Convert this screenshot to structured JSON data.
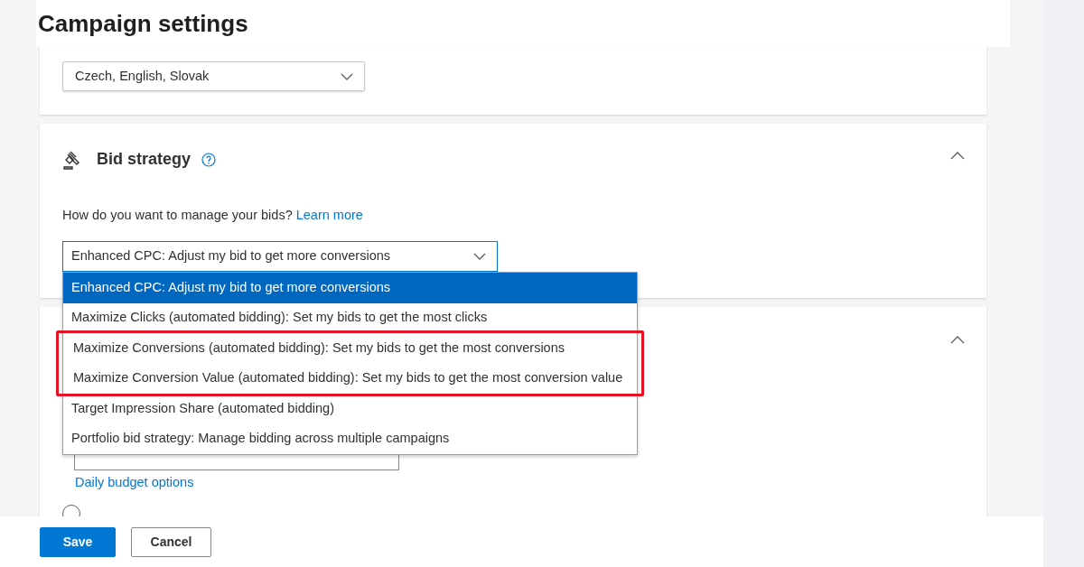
{
  "page": {
    "title": "Campaign settings"
  },
  "languages": {
    "value": "Czech, English, Slovak"
  },
  "bid_strategy": {
    "title": "Bid strategy",
    "expanded": true,
    "prompt": "How do you want to manage your bids?",
    "link": "Learn more",
    "dropdown": {
      "value": "Enhanced CPC: Adjust my bid to get more conversions",
      "expanded": true,
      "options": [
        {
          "label": "Enhanced CPC: Adjust my bid to get more conversions",
          "selected": true,
          "highlighted": false
        },
        {
          "label": "Maximize Clicks (automated bidding): Set my bids to get the most clicks",
          "selected": false,
          "highlighted": false
        },
        {
          "label": "Maximize Conversions (automated bidding): Set my bids to get the most conversions",
          "selected": false,
          "highlighted": true
        },
        {
          "label": "Maximize Conversion Value (automated bidding): Set my bids to get the most conversion value",
          "selected": false,
          "highlighted": true
        },
        {
          "label": "Target Impression Share (automated bidding)",
          "selected": false,
          "highlighted": false
        },
        {
          "label": "Portfolio bid strategy: Manage bidding across multiple campaigns",
          "selected": false,
          "highlighted": false
        }
      ]
    }
  },
  "budget": {
    "expanded": true,
    "options_link": "Daily budget options",
    "shared_option": {
      "selected": false
    }
  },
  "footer": {
    "buttons": [
      {
        "label": "Save",
        "kind": "primary"
      },
      {
        "label": "Cancel",
        "kind": "secondary"
      }
    ]
  }
}
